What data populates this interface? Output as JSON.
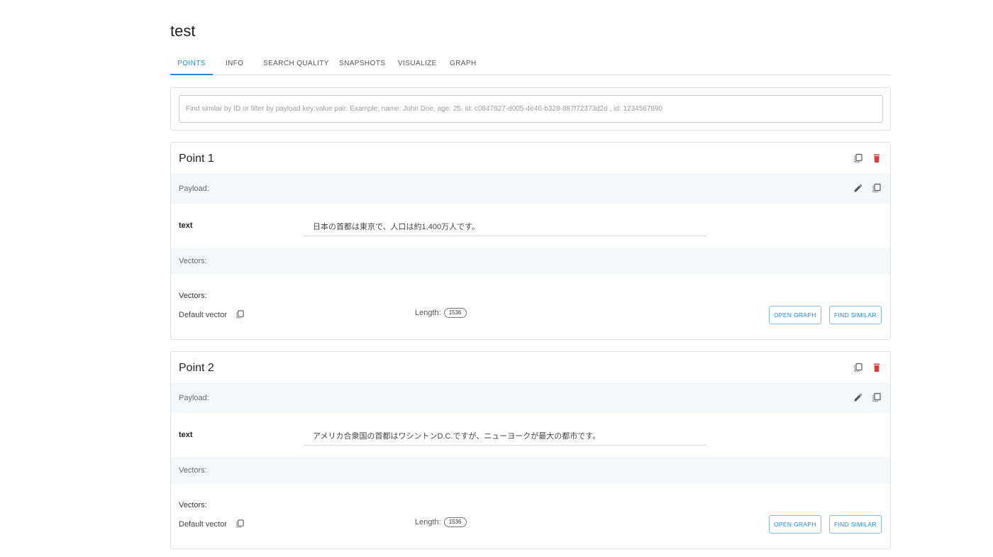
{
  "collection": {
    "title": "test"
  },
  "tabs": [
    {
      "label": "POINTS",
      "active": true
    },
    {
      "label": "INFO",
      "active": false
    },
    {
      "label": "SEARCH QUALITY",
      "active": false
    },
    {
      "label": "SNAPSHOTS",
      "active": false
    },
    {
      "label": "VISUALIZE",
      "active": false
    },
    {
      "label": "GRAPH",
      "active": false
    }
  ],
  "search": {
    "placeholder": "Find similar by ID or filter by payload key:value pair. Example: name: John Doe, age: 25, id: c0847827-d005-4e46-b328-887f72373d2d , id: 1234567890",
    "value": ""
  },
  "colors": {
    "accent": "#1e88e5",
    "delete": "#e53935",
    "band": "#f4f7fb"
  },
  "points": [
    {
      "title": "Point 1",
      "payload_label": "Payload:",
      "payload": [
        {
          "key": "text",
          "value": "日本の首都は東京で、人口は約1,400万人です。"
        }
      ],
      "vectors_band_label": "Vectors:",
      "vectors_heading": "Vectors:",
      "vector_name": "Default vector",
      "length_label": "Length:",
      "length_value": "1536",
      "open_graph_label": "OPEN GRAPH",
      "find_similar_label": "FIND SIMILAR"
    },
    {
      "title": "Point 2",
      "payload_label": "Payload:",
      "payload": [
        {
          "key": "text",
          "value": "アメリカ合衆国の首都はワシントンD.C.ですが、ニューヨークが最大の都市です。"
        }
      ],
      "vectors_band_label": "Vectors:",
      "vectors_heading": "Vectors:",
      "vector_name": "Default vector",
      "length_label": "Length:",
      "length_value": "1536",
      "open_graph_label": "OPEN GRAPH",
      "find_similar_label": "FIND SIMILAR"
    }
  ],
  "icons": {
    "copy": "copy-icon",
    "delete": "trash-icon",
    "edit": "pencil-icon"
  }
}
